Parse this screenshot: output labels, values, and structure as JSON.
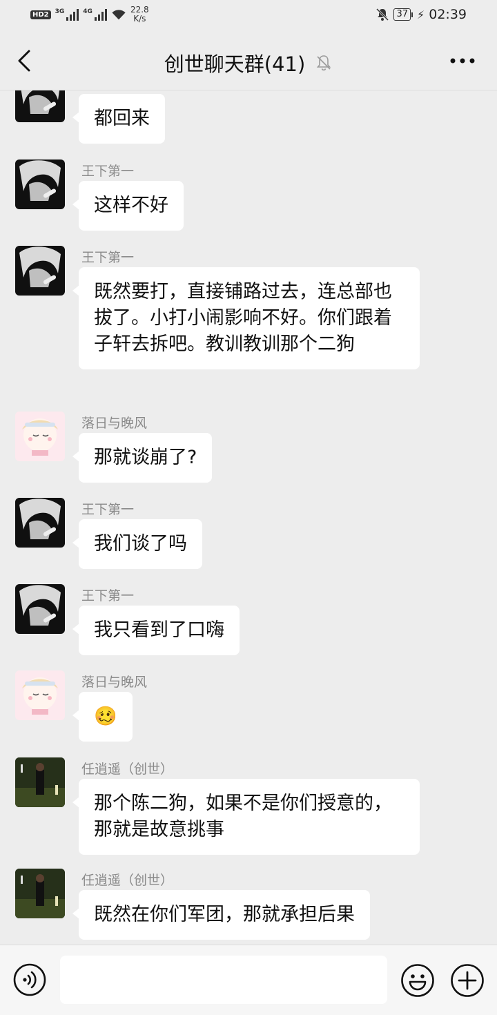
{
  "status_bar": {
    "hd": "HD",
    "sim": "2",
    "net1": "3G",
    "net2": "4G",
    "speed_value": "22.8",
    "speed_unit": "K/s",
    "battery": "37",
    "time": "02:39"
  },
  "header": {
    "title": "创世聊天群(41)",
    "back_icon": "chevron-left-icon",
    "mute_icon": "bell-off-icon",
    "more_icon": "more-dots-icon"
  },
  "messages": [
    {
      "sender": "",
      "text": "都回来",
      "avatar": "dark-anime-avatar"
    },
    {
      "sender": "王下第一",
      "text": "这样不好",
      "avatar": "dark-anime-avatar"
    },
    {
      "sender": "王下第一",
      "text": "既然要打，直接铺路过去，连总部也拔了。小打小闹影响不好。你们跟着子轩去拆吧。教训教训那个二狗",
      "avatar": "dark-anime-avatar"
    },
    {
      "sender": "落日与晚风",
      "text": "那就谈崩了?",
      "avatar": "chibi-anime-avatar"
    },
    {
      "sender": "王下第一",
      "text": "我们谈了吗",
      "avatar": "dark-anime-avatar"
    },
    {
      "sender": "王下第一",
      "text": "我只看到了口嗨",
      "avatar": "dark-anime-avatar"
    },
    {
      "sender": "落日与晚风",
      "text": "🥴",
      "avatar": "chibi-anime-avatar"
    },
    {
      "sender": "任逍遥（创世）",
      "text": "那个陈二狗，如果不是你们授意的，那就是故意挑事",
      "avatar": "photo-avatar"
    },
    {
      "sender": "任逍遥（创世）",
      "text": "既然在你们军团，那就承担后果",
      "avatar": "photo-avatar"
    }
  ],
  "input_bar": {
    "voice_icon": "voice-icon",
    "emoji_icon": "emoji-icon",
    "plus_icon": "plus-circle-icon",
    "input_value": ""
  }
}
